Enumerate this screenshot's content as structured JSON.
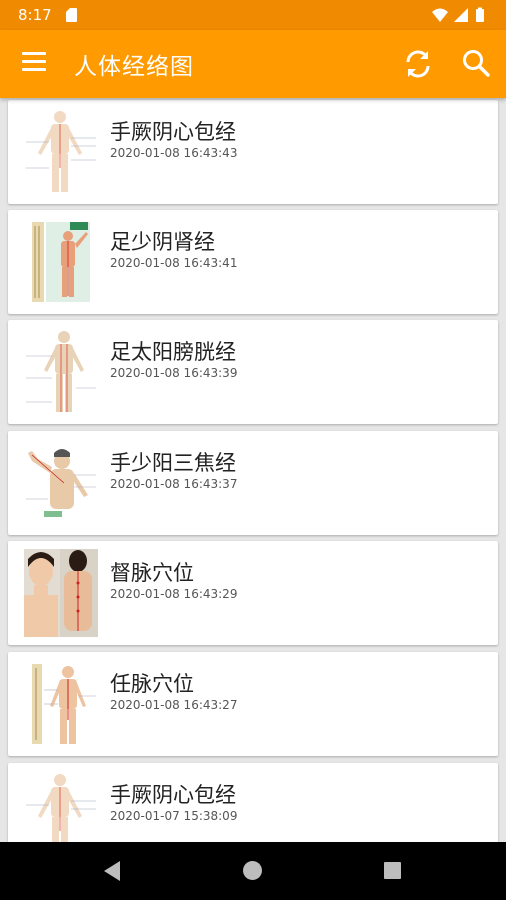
{
  "status": {
    "time": "8:17"
  },
  "app_bar": {
    "title": "人体经络图",
    "menu_icon": "hamburger-menu-icon",
    "refresh_icon": "refresh-icon",
    "search_icon": "search-icon"
  },
  "colors": {
    "status_bar": "#f08a00",
    "app_bar": "#ff9a00",
    "background": "#e6e6e6"
  },
  "items": [
    {
      "title": "手厥阴心包经",
      "time": "2020-01-08 16:43:43",
      "thumbnail": "meridian-figure-front"
    },
    {
      "title": "足少阴肾经",
      "time": "2020-01-08 16:43:41",
      "thumbnail": "meridian-chart-kidney"
    },
    {
      "title": "足太阳膀胱经",
      "time": "2020-01-08 16:43:39",
      "thumbnail": "meridian-figure-back"
    },
    {
      "title": "手少阳三焦经",
      "time": "2020-01-08 16:43:37",
      "thumbnail": "meridian-figure-arm"
    },
    {
      "title": "督脉穴位",
      "time": "2020-01-08 16:43:29",
      "thumbnail": "governor-vessel-photo"
    },
    {
      "title": "任脉穴位",
      "time": "2020-01-08 16:43:27",
      "thumbnail": "conception-vessel-chart"
    },
    {
      "title": "手厥阴心包经",
      "time": "2020-01-07 15:38:09",
      "thumbnail": "meridian-figure-front"
    }
  ]
}
